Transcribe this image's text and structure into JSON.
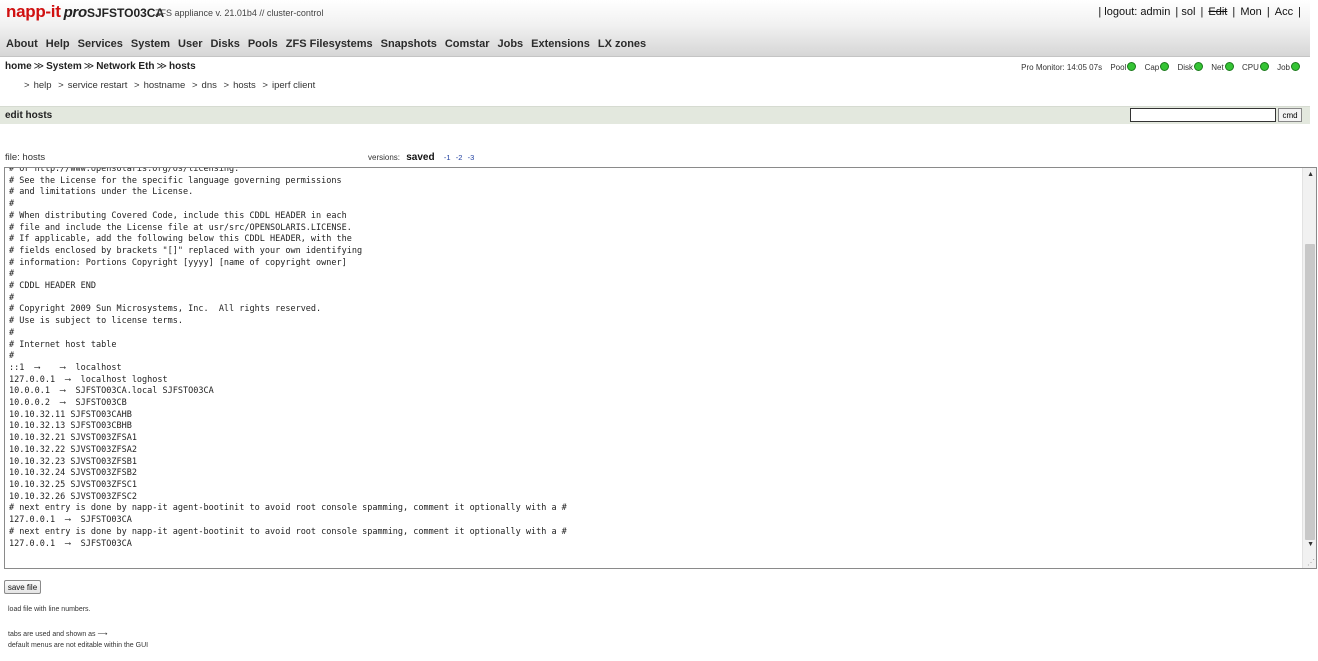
{
  "header": {
    "logo": "napp-it",
    "logo_suffix": "pro",
    "hostname": "SJFSTO03CA",
    "appline": "ZFS appliance v. 21.01b4 // cluster-control",
    "top_links": [
      "| logout: admin",
      "| sol",
      "|",
      "Edit",
      "|",
      "Mon",
      "|",
      "Acc",
      "|"
    ],
    "menu": [
      "About",
      "Help",
      "Services",
      "System",
      "User",
      "Disks",
      "Pools",
      "ZFS Filesystems",
      "Snapshots",
      "Comstar",
      "Jobs",
      "Extensions",
      "LX zones"
    ]
  },
  "breadcrumb": [
    "home",
    "System",
    "Network Eth",
    "hosts"
  ],
  "breadcrumb_sep": "≫",
  "monitor": {
    "label": "Pro Monitor: 14:05 07s",
    "items": [
      "Pool",
      "Cap",
      "Disk",
      "Net",
      "CPU",
      "Job"
    ],
    "status_color": "#35c435"
  },
  "sublinks": [
    "help",
    "service restart",
    "hostname",
    "dns",
    "hosts",
    "iperf client"
  ],
  "sublink_prefix": ">",
  "section": {
    "title": "edit hosts",
    "cmd_value": "",
    "cmd_button": "cmd"
  },
  "file": {
    "label": "file: hosts",
    "versions_label": "versions:",
    "saved": "saved",
    "versions": [
      "-1",
      "-2",
      "-3"
    ]
  },
  "editor_content": "# or http://www.opensolaris.org/os/licensing.\n# See the License for the specific language governing permissions\n# and limitations under the License.\n#\n# When distributing Covered Code, include this CDDL HEADER in each\n# file and include the License file at usr/src/OPENSOLARIS.LICENSE.\n# If applicable, add the following below this CDDL HEADER, with the\n# fields enclosed by brackets \"[]\" replaced with your own identifying\n# information: Portions Copyright [yyyy] [name of copyright owner]\n#\n# CDDL HEADER END\n#\n# Copyright 2009 Sun Microsystems, Inc.  All rights reserved.\n# Use is subject to license terms.\n#\n# Internet host table\n#\n::1  ⟶    ⟶  localhost\n127.0.0.1  ⟶  localhost loghost\n10.0.0.1  ⟶  SJFSTO03CA.local SJFSTO03CA\n10.0.0.2  ⟶  SJFSTO03CB\n10.10.32.11 SJFSTO03CAHB\n10.10.32.13 SJFSTO03CBHB\n10.10.32.21 SJVSTO03ZFSA1\n10.10.32.22 SJVSTO03ZFSA2\n10.10.32.23 SJVSTO03ZFSB1\n10.10.32.24 SJVSTO03ZFSB2\n10.10.32.25 SJVSTO03ZFSC1\n10.10.32.26 SJVSTO03ZFSC2\n# next entry is done by napp-it agent-bootinit to avoid root console spamming, comment it optionally with a #\n127.0.0.1  ⟶  SJFSTO03CA\n# next entry is done by napp-it agent-bootinit to avoid root console spamming, comment it optionally with a #\n127.0.0.1  ⟶  SJFSTO03CA",
  "footer": {
    "save_button": "save file",
    "load_link": "load file with line numbers.",
    "note_tabs": "tabs are used and shown as ⟶",
    "note_default": "default menus are not editable within the GUI"
  },
  "icons": {
    "scroll_up": "scroll-up-arrow-icon",
    "scroll_down": "scroll-down-arrow-icon",
    "status": "status-dot-icon"
  }
}
